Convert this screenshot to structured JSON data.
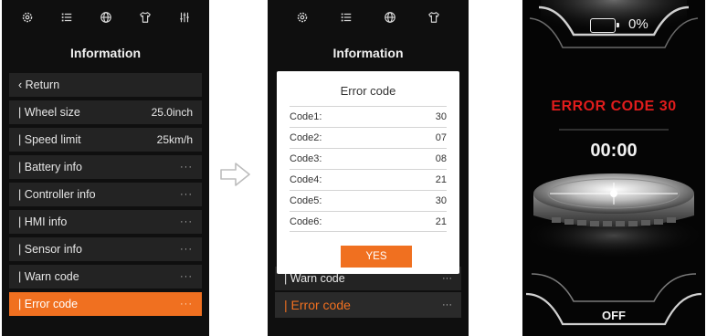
{
  "screen1": {
    "title": "Information",
    "top_icons": [
      "gear-icon",
      "list-icon",
      "globe-icon",
      "shirt-icon",
      "sliders-icon"
    ],
    "items": [
      {
        "label": "Return",
        "value": ""
      },
      {
        "label": "Wheel size",
        "value": "25.0inch"
      },
      {
        "label": "Speed limit",
        "value": "25km/h"
      },
      {
        "label": "Battery info",
        "value": "···"
      },
      {
        "label": "Controller info",
        "value": "···"
      },
      {
        "label": "HMI info",
        "value": "···"
      },
      {
        "label": "Sensor info",
        "value": "···"
      },
      {
        "label": "Warn code",
        "value": "···"
      },
      {
        "label": "Error code",
        "value": "···"
      }
    ]
  },
  "screen2": {
    "title": "Information",
    "top_icons": [
      "gear-icon",
      "list-icon",
      "globe-icon",
      "shirt-icon"
    ],
    "under_warn_label": "Warn code",
    "under_warn_value": "···",
    "under_error_label": "Error code",
    "under_error_value": "···",
    "dialog": {
      "title": "Error code",
      "codes": [
        {
          "label": "Code1:",
          "value": "30"
        },
        {
          "label": "Code2:",
          "value": "07"
        },
        {
          "label": "Code3:",
          "value": "08"
        },
        {
          "label": "Code4:",
          "value": "21"
        },
        {
          "label": "Code5:",
          "value": "30"
        },
        {
          "label": "Code6:",
          "value": "21"
        }
      ],
      "yes_label": "YES"
    }
  },
  "screen3": {
    "battery_percent": "0%",
    "error_text": "ERROR CODE 30",
    "timer": "00:00",
    "power_label": "OFF",
    "colors": {
      "error": "#e01c1c",
      "accent": "#f07020"
    }
  }
}
